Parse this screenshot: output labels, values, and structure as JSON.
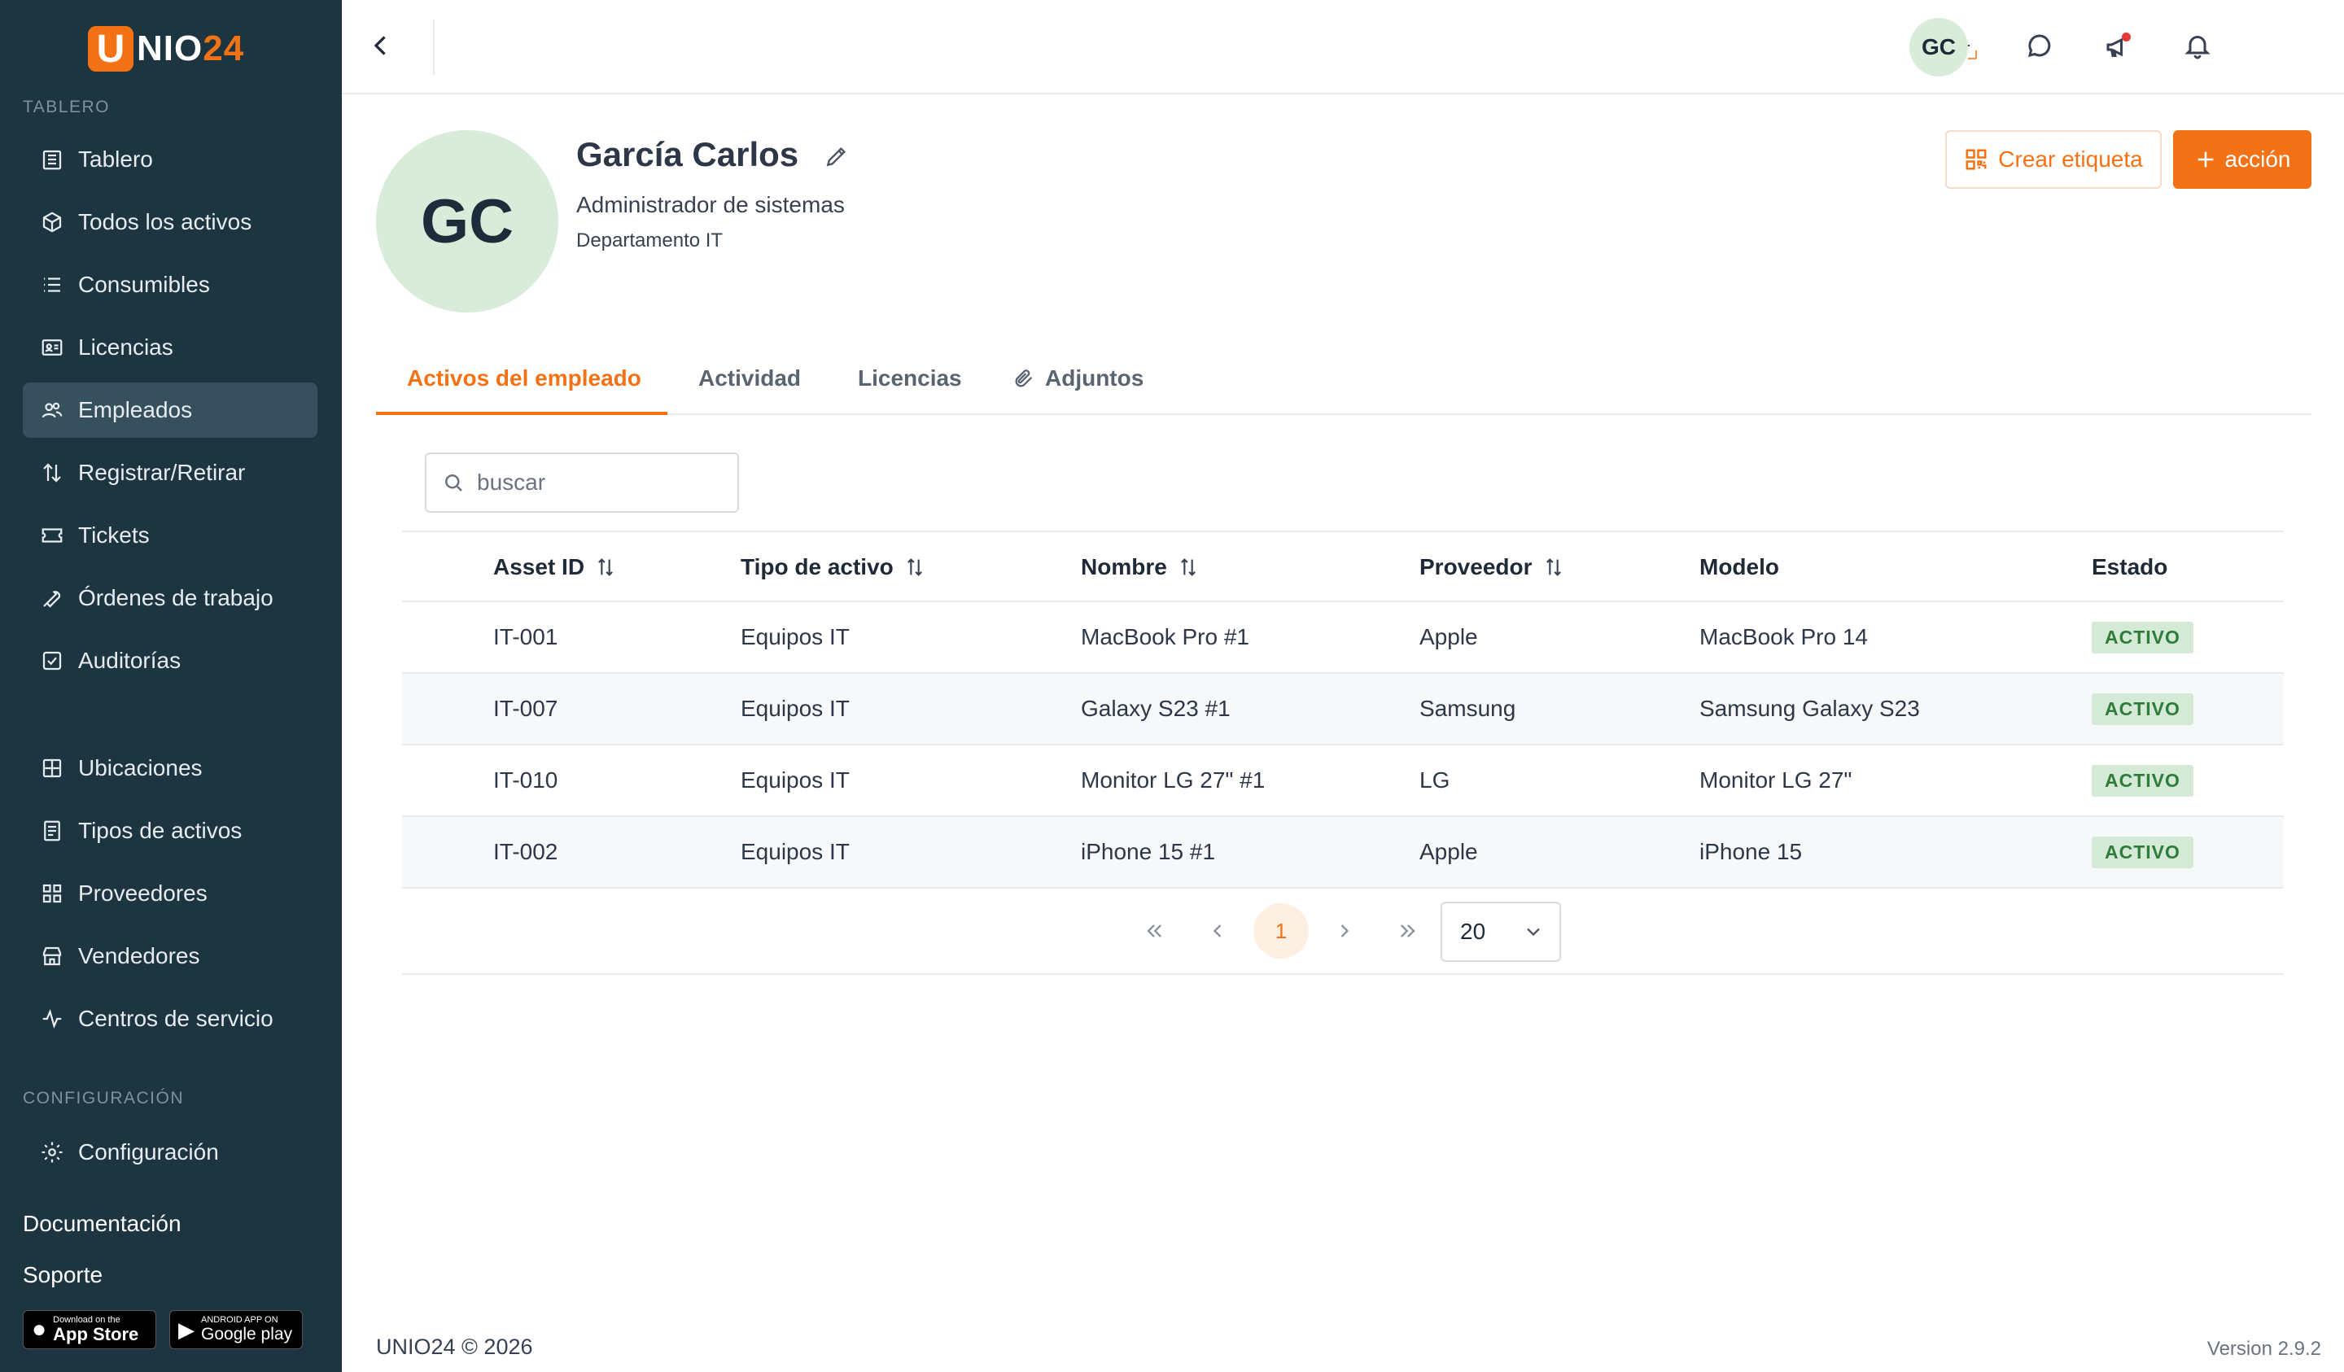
{
  "brand": {
    "logo_letter": "U",
    "logo_text_a": "NIO",
    "logo_text_b": "24",
    "accent_color": "#f47216",
    "sidebar_color": "#1d3441"
  },
  "sidebar": {
    "section_main": "TABLERO",
    "items": [
      {
        "label": "Tablero",
        "icon": "building-icon"
      },
      {
        "label": "Todos los activos",
        "icon": "cube-icon"
      },
      {
        "label": "Consumibles",
        "icon": "list-icon"
      },
      {
        "label": "Licencias",
        "icon": "id-card-icon"
      },
      {
        "label": "Empleados",
        "icon": "users-icon",
        "active": true
      },
      {
        "label": "Registrar/Retirar",
        "icon": "arrows-up-down-icon"
      },
      {
        "label": "Tickets",
        "icon": "ticket-icon"
      },
      {
        "label": "Órdenes de trabajo",
        "icon": "wrench-icon"
      },
      {
        "label": "Auditorías",
        "icon": "checkbox-icon"
      }
    ],
    "items2": [
      {
        "label": "Ubicaciones",
        "icon": "grid-icon"
      },
      {
        "label": "Tipos de activos",
        "icon": "document-icon"
      },
      {
        "label": "Proveedores",
        "icon": "blocks-icon"
      },
      {
        "label": "Vendedores",
        "icon": "store-icon"
      },
      {
        "label": "Centros de servicio",
        "icon": "activity-icon"
      }
    ],
    "section_config": "CONFIGURACIÓN",
    "config_item": {
      "label": "Configuración",
      "icon": "gear-icon"
    },
    "links": {
      "docs": "Documentación",
      "support": "Soporte"
    },
    "stores": {
      "apple_small": "Download on the",
      "apple_big": "App Store",
      "google_small": "ANDROID APP ON",
      "google_big": "Google play"
    }
  },
  "topbar": {
    "avatar": "GC"
  },
  "profile": {
    "initials": "GC",
    "name": "García Carlos",
    "role": "Administrador de sistemas",
    "department": "Departamento IT",
    "btn_label": "Crear etiqueta",
    "btn_action": "acción"
  },
  "tabs": [
    "Activos del empleado",
    "Actividad",
    "Licencias",
    "Adjuntos"
  ],
  "search": {
    "placeholder": "buscar",
    "value": ""
  },
  "table": {
    "headers": [
      "Asset ID",
      "Tipo de activo",
      "Nombre",
      "Proveedor",
      "Modelo",
      "Estado"
    ],
    "rows": [
      [
        "IT-001",
        "Equipos IT",
        "MacBook Pro #1",
        "Apple",
        "MacBook Pro 14",
        "ACTIVO"
      ],
      [
        "IT-007",
        "Equipos IT",
        "Galaxy S23 #1",
        "Samsung",
        "Samsung Galaxy S23",
        "ACTIVO"
      ],
      [
        "IT-010",
        "Equipos IT",
        "Monitor LG 27\" #1",
        "LG",
        "Monitor LG 27\"",
        "ACTIVO"
      ],
      [
        "IT-002",
        "Equipos IT",
        "iPhone 15 #1",
        "Apple",
        "iPhone 15",
        "ACTIVO"
      ]
    ]
  },
  "pagination": {
    "current": "1",
    "page_size": "20"
  },
  "footer": {
    "copyright": "UNIO24 © 2026",
    "version": "Version 2.9.2"
  }
}
